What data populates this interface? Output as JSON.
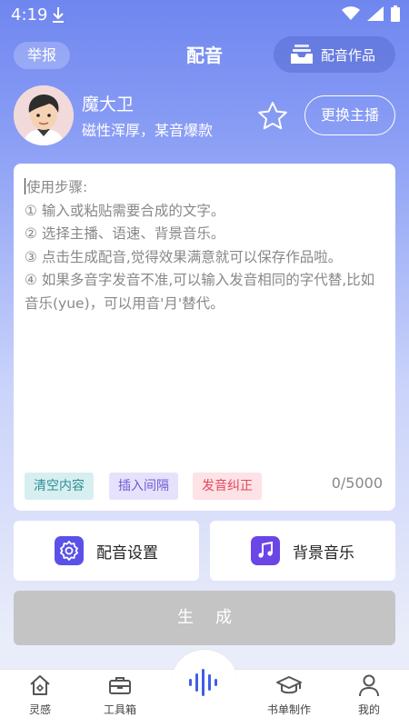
{
  "status_bar": {
    "time": "4:19"
  },
  "header": {
    "report_label": "举报",
    "title": "配音",
    "works_label": "配音作品"
  },
  "anchor": {
    "name": "魔大卫",
    "description": "磁性浑厚，某音爆款",
    "change_label": "更换主播"
  },
  "editor": {
    "lines": [
      "使用步骤:",
      "① 输入或粘贴需要合成的文字。",
      "② 选择主播、语速、背景音乐。",
      "③ 点击生成配音,觉得效果满意就可以保存作品啦。",
      "④ 如果多音字发音不准,可以输入发音相同的字代替,比如音乐(yue)，可以用音'月'替代。"
    ],
    "chips": {
      "clear": "清空内容",
      "interval": "插入间隔",
      "pronunciation": "发音纠正"
    },
    "char_count": "0/5000"
  },
  "settings": {
    "voice_settings": "配音设置",
    "background_music": "背景音乐"
  },
  "generate_label": "生成",
  "tabbar": {
    "inspiration": "灵感",
    "toolbox": "工具箱",
    "booklist": "书单制作",
    "mine": "我的"
  },
  "colors": {
    "accent": "#5a52e8",
    "gradient_top": "#6f86ef",
    "chip_clear": "#2f8e96",
    "chip_interval": "#6e5bd4",
    "chip_fix": "#e2485d"
  }
}
